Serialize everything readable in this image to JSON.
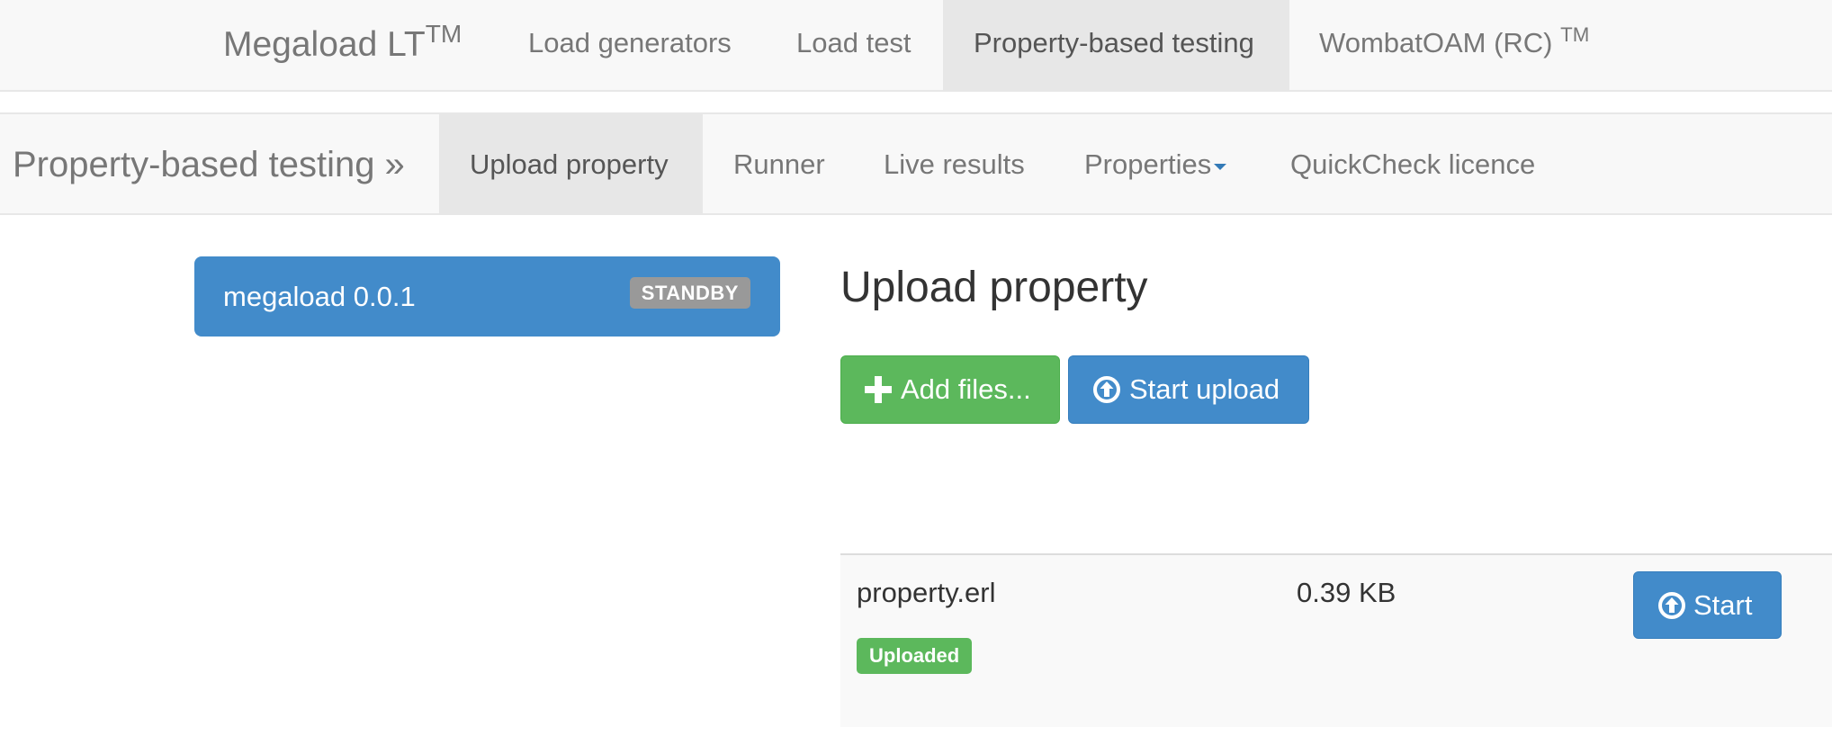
{
  "topnav": {
    "brand": "Megaload LT",
    "brand_sup": "TM",
    "items": [
      {
        "label": "Load generators"
      },
      {
        "label": "Load test"
      },
      {
        "label": "Property-based testing"
      },
      {
        "label": "WombatOAM (RC) ",
        "sup": "TM"
      }
    ],
    "active": "Property-based testing"
  },
  "subnav": {
    "title": "Property-based testing »",
    "items": [
      {
        "label": "Upload property"
      },
      {
        "label": "Runner"
      },
      {
        "label": "Live results"
      },
      {
        "label": "Properties"
      },
      {
        "label": "QuickCheck licence"
      }
    ],
    "active": "Upload property"
  },
  "node_panel": {
    "name": "megaload 0.0.1",
    "status": "STANDBY"
  },
  "upload": {
    "heading": "Upload property",
    "add_files_label": "Add files...",
    "start_upload_label": "Start upload"
  },
  "files": [
    {
      "name": "property.erl",
      "size": "0.39 KB",
      "status": "Uploaded",
      "start_label": "Start"
    }
  ],
  "icons": {
    "add": "plus-icon",
    "upload": "circle-arrow-up-icon",
    "properties_dropdown": "caret-down-icon"
  },
  "colors": {
    "primary": "#428bca",
    "success": "#5cb85c",
    "default_badge": "#999999",
    "nav_background": "#f8f8f8",
    "nav_active": "#e7e7e7"
  }
}
